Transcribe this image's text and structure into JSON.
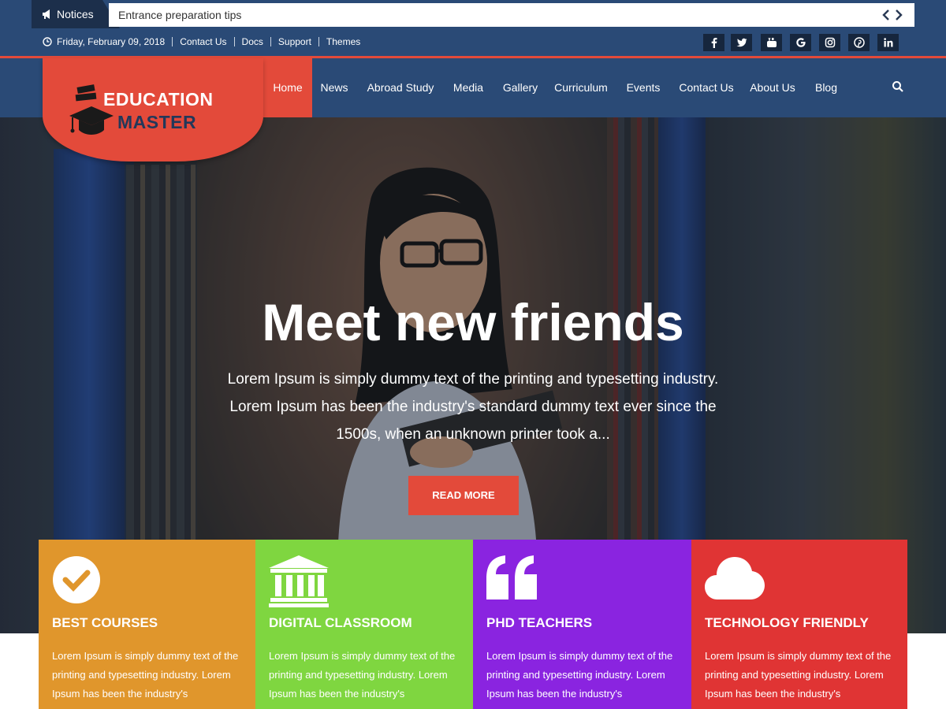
{
  "notice": {
    "label": "Notices",
    "text": "Entrance preparation tips"
  },
  "meta": {
    "date": "Friday, February 09, 2018",
    "links": [
      "Contact Us",
      "Docs",
      "Support",
      "Themes"
    ]
  },
  "social": [
    "facebook-icon",
    "twitter-icon",
    "youtube-icon",
    "google-icon",
    "instagram-icon",
    "pinterest-icon",
    "linkedin-icon"
  ],
  "logo": {
    "line1": "EDUCATION",
    "line2": "MASTER"
  },
  "nav": {
    "items": [
      "Home",
      "News",
      "Abroad Study",
      "Media",
      "Gallery",
      "Curriculum",
      "Events",
      "Contact Us",
      "About Us",
      "Blog"
    ],
    "active": "Home"
  },
  "hero": {
    "title": "Meet new friends",
    "subtitle": "Lorem Ipsum is simply dummy text of the printing and typesetting industry. Lorem Ipsum has been the industry's standard dummy text ever since the 1500s, when an unknown printer took a...",
    "button": "READ MORE"
  },
  "features": [
    {
      "title": "BEST COURSES",
      "icon": "check-circle-icon",
      "color": "#e0962c",
      "text": "Lorem Ipsum is simply dummy text of the printing and typesetting industry. Lorem Ipsum has been the industry's"
    },
    {
      "title": "DIGITAL CLASSROOM",
      "icon": "institution-icon",
      "color": "#7fd640",
      "text": "Lorem Ipsum is simply dummy text of the printing and typesetting industry. Lorem Ipsum has been the industry's"
    },
    {
      "title": "PHD TEACHERS",
      "icon": "quote-icon",
      "color": "#8a24e0",
      "text": "Lorem Ipsum is simply dummy text of the printing and typesetting industry. Lorem Ipsum has been the industry's"
    },
    {
      "title": "TECHNOLOGY FRIENDLY",
      "icon": "cloud-icon",
      "color": "#e03434",
      "text": "Lorem Ipsum is simply dummy text of the printing and typesetting industry. Lorem Ipsum has been the industry's"
    }
  ],
  "colors": {
    "primary": "#2a4a76",
    "accent": "#e34a3a",
    "dark": "#1c2f4b"
  }
}
